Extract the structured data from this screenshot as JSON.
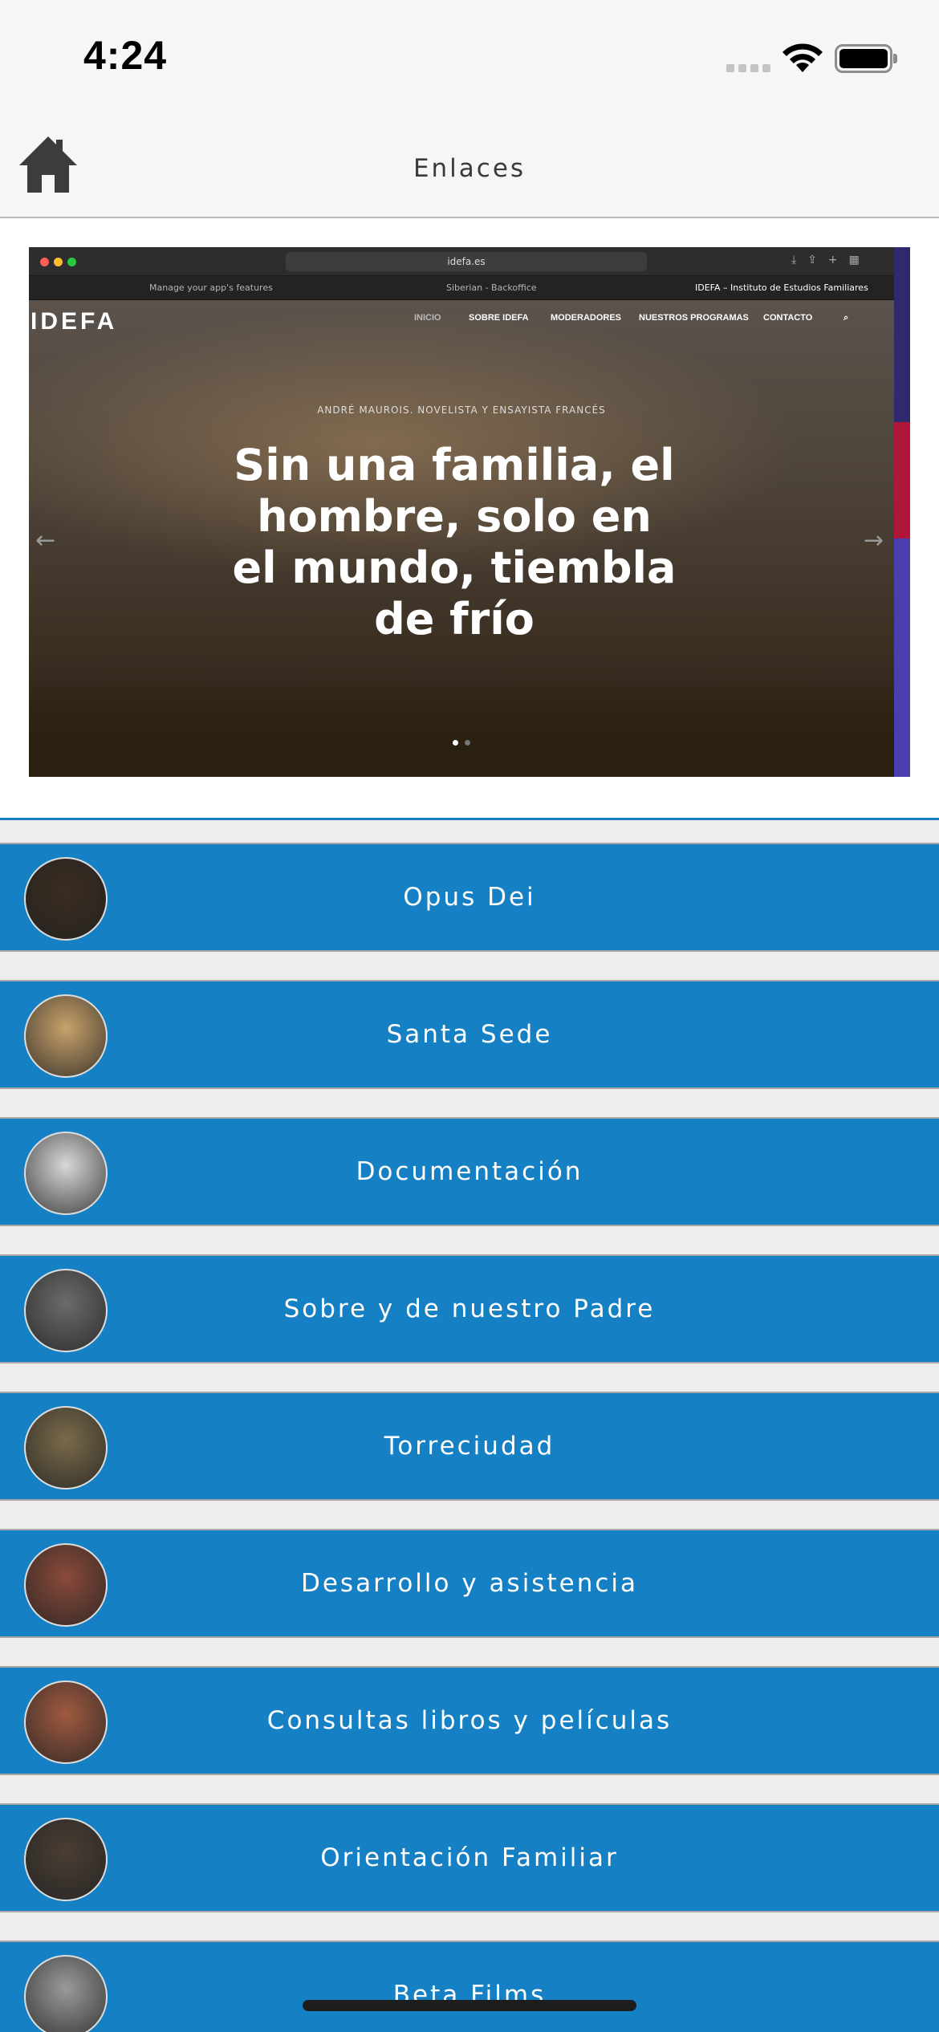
{
  "status_bar": {
    "time": "4:24"
  },
  "nav": {
    "title": "Enlaces"
  },
  "banner": {
    "browser_url": "idefa.es",
    "tabs": [
      "Manage your app's features",
      "Siberian - Backoffice",
      "IDEFA – Instituto de Estudios Familiares"
    ],
    "site_logo": "IDEFA",
    "site_nav": [
      "INICIO",
      "SOBRE IDEFA",
      "MODERADORES",
      "NUESTROS PROGRAMAS",
      "CONTACTO"
    ],
    "quote_author": "ANDRÉ MAUROIS. NOVELISTA Y ENSAYISTA FRANCÉS",
    "quote": "Sin una familia, el hombre, solo en el mundo, tiembla de frío"
  },
  "links": [
    {
      "label": "Opus Dei",
      "thumb_color": "#3a2c20"
    },
    {
      "label": "Santa Sede",
      "thumb_color": "#c9a26b"
    },
    {
      "label": "Documentación",
      "thumb_color": "#d8d8d8"
    },
    {
      "label": "Sobre y de nuestro Padre",
      "thumb_color": "#6b6b6b"
    },
    {
      "label": "Torreciudad",
      "thumb_color": "#7a6a4a"
    },
    {
      "label": "Desarrollo y asistencia",
      "thumb_color": "#8a4a3a"
    },
    {
      "label": "Consultas libros y películas",
      "thumb_color": "#a05a40"
    },
    {
      "label": "Orientación Familiar",
      "thumb_color": "#4a3e34"
    },
    {
      "label": "Beta Films",
      "thumb_color": "#9a9a9a"
    }
  ]
}
